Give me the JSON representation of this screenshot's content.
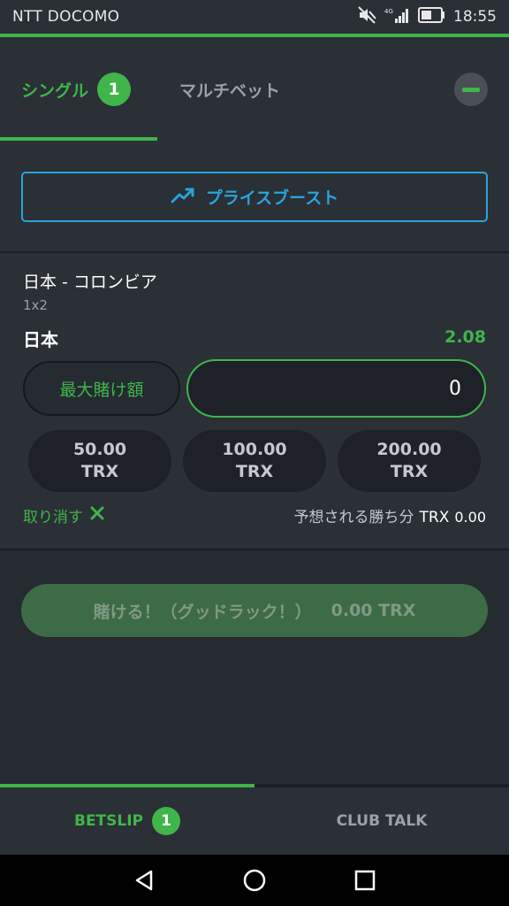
{
  "status_bar": {
    "carrier": "NTT DOCOMO",
    "network": "4G",
    "time": "18:55"
  },
  "tabs": {
    "single_label": "シングル",
    "single_count": "1",
    "multi_label": "マルチベット"
  },
  "price_boost": {
    "label": "プライスブースト"
  },
  "bet": {
    "match": "日本 - コロンビア",
    "market": "1x2",
    "selection": "日本",
    "odds": "2.08",
    "max_stake_label": "最大賭け額",
    "stake_value": "0",
    "quick_amounts": [
      {
        "amount": "50.00",
        "currency": "TRX"
      },
      {
        "amount": "100.00",
        "currency": "TRX"
      },
      {
        "amount": "200.00",
        "currency": "TRX"
      }
    ],
    "cancel_label": "取り消す",
    "returns_label": "予想される勝ち分",
    "returns_currency": "TRX",
    "returns_value": "0.00"
  },
  "place_bet": {
    "label": "賭ける！（グッドラック！）",
    "amount": "0.00 TRX"
  },
  "bottom_tabs": {
    "betslip_label": "BETSLIP",
    "betslip_count": "1",
    "club_talk_label": "CLUB TALK"
  },
  "colors": {
    "accent": "#3fb54a",
    "boost": "#27a4dc",
    "background": "#262a31",
    "panel": "#2b2f36"
  },
  "icons": [
    "mute-icon",
    "signal-icon",
    "battery-icon",
    "trending-up-icon",
    "close-icon",
    "back-icon",
    "home-icon",
    "recents-icon"
  ]
}
